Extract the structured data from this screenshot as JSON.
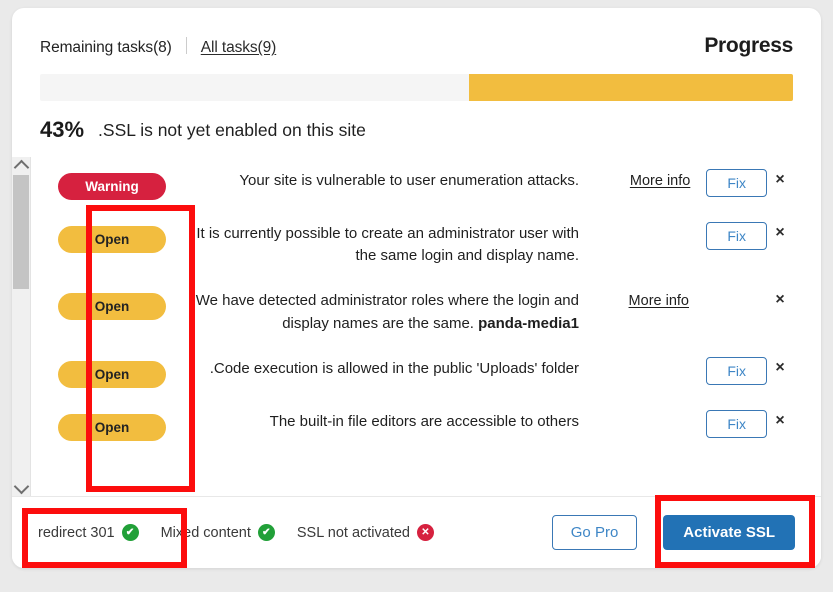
{
  "header": {
    "tab_remaining": "Remaining tasks(8)",
    "tab_all": "All tasks(9)",
    "progress_title": "Progress"
  },
  "progress": {
    "percent": 43,
    "percent_label": "43%",
    "caption": ".SSL is not yet enabled on this site",
    "fill_color": "#f2bd3f",
    "track_color": "#f5f5f5"
  },
  "tasks": [
    {
      "dismiss": "×",
      "fix_label": "Fix",
      "more_label": "More info",
      "description": "Your site is vulnerable to user enumeration attacks.",
      "status": "Warning",
      "status_kind": "warning"
    },
    {
      "dismiss": "×",
      "fix_label": "Fix",
      "more_label": "",
      "description": "It is currently possible to create an administrator user with the same login and display name.",
      "status": "Open",
      "status_kind": "open"
    },
    {
      "dismiss": "×",
      "fix_label": "",
      "more_label": "More info",
      "description": "We have detected administrator roles where the login and display names are the same. panda-media1",
      "description_bold": "panda-media1",
      "status": "Open",
      "status_kind": "open"
    },
    {
      "dismiss": "×",
      "fix_label": "Fix",
      "more_label": "",
      "description": ".Code execution is allowed in the public 'Uploads' folder",
      "status": "Open",
      "status_kind": "open"
    },
    {
      "dismiss": "×",
      "fix_label": "Fix",
      "more_label": "",
      "description": "The built-in file editors are accessible to others",
      "status": "Open",
      "status_kind": "open"
    }
  ],
  "footer": {
    "statuses": [
      {
        "label": "redirect 301",
        "icon": "check-circle-icon",
        "glyph": "✔",
        "state": "ok"
      },
      {
        "label": "Mixed content",
        "icon": "check-circle-icon",
        "glyph": "✔",
        "state": "ok"
      },
      {
        "label": "SSL not activated",
        "icon": "cross-circle-icon",
        "glyph": "✕",
        "state": "bad"
      }
    ],
    "go_pro": "Go Pro",
    "activate_ssl": "Activate SSL"
  },
  "scrollbar": {
    "up_icon": "chevron-up-icon",
    "down_icon": "chevron-down-icon"
  },
  "annotations": {
    "accent": "#fc0d0d"
  },
  "colors": {
    "amber": "#f2bd3f",
    "crimson": "#d6213f",
    "green": "#21a038",
    "primary_blue": "#2272b5",
    "link_blue": "#3e86c6",
    "page_bg": "#eaeaea"
  }
}
